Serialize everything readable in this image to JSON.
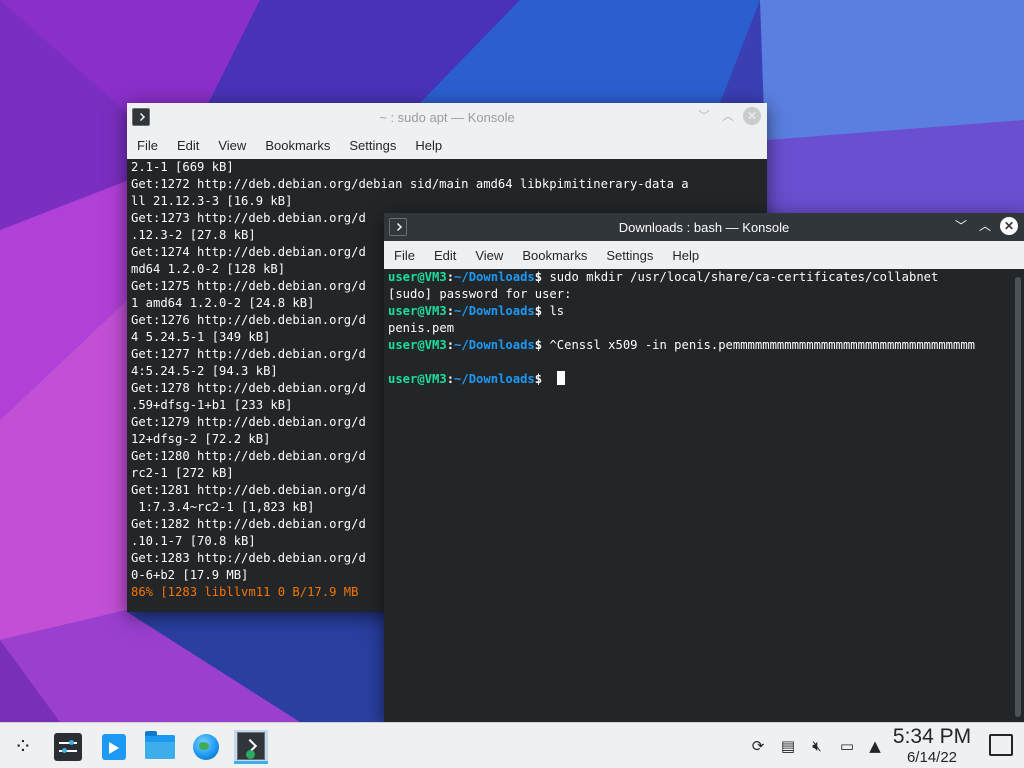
{
  "wallpaper": {
    "colors": [
      "#4a1f9e",
      "#8a3fd0",
      "#2c5fcf",
      "#6b7fd8"
    ]
  },
  "back_window": {
    "title": "~ : sudo apt — Konsole",
    "menu": [
      "File",
      "Edit",
      "View",
      "Bookmarks",
      "Settings",
      "Help"
    ],
    "lines": [
      "2.1-1 [669 kB]",
      "Get:1272 http://deb.debian.org/debian sid/main amd64 libkpimitinerary-data a",
      "ll 21.12.3-3 [16.9 kB]",
      "Get:1273 http://deb.debian.org/d",
      ".12.3-2 [27.8 kB]",
      "Get:1274 http://deb.debian.org/d",
      "md64 1.2.0-2 [128 kB]",
      "Get:1275 http://deb.debian.org/d",
      "1 amd64 1.2.0-2 [24.8 kB]",
      "Get:1276 http://deb.debian.org/d",
      "4 5.24.5-1 [349 kB]",
      "Get:1277 http://deb.debian.org/d",
      "4:5.24.5-2 [94.3 kB]",
      "Get:1278 http://deb.debian.org/d",
      ".59+dfsg-1+b1 [233 kB]",
      "Get:1279 http://deb.debian.org/d",
      "12+dfsg-2 [72.2 kB]",
      "Get:1280 http://deb.debian.org/d",
      "rc2-1 [272 kB]",
      "Get:1281 http://deb.debian.org/d",
      " 1:7.3.4~rc2-1 [1,823 kB]",
      "Get:1282 http://deb.debian.org/d",
      ".10.1-7 [70.8 kB]",
      "Get:1283 http://deb.debian.org/d",
      "0-6+b2 [17.9 MB]"
    ],
    "progress_line": "86% [1283 libllvm11 0 B/17.9 MB"
  },
  "front_window": {
    "title": "Downloads : bash — Konsole",
    "menu": [
      "File",
      "Edit",
      "View",
      "Bookmarks",
      "Settings",
      "Help"
    ],
    "prompt_user": "user@VM3",
    "prompt_sep": ":",
    "prompt_path": "~/Downloads",
    "prompt_sign": "$",
    "entries": [
      {
        "cmd": " sudo mkdir /usr/local/share/ca-certificates/collabnet",
        "output": "[sudo] password for user:"
      },
      {
        "cmd": " ls",
        "output": "penis.pem"
      },
      {
        "cmd": " ^Censsl x509 -in penis.pemmmmmmmmmmmmmmmmmmmmmmmmmmmmmmmmm",
        "output": ""
      }
    ]
  },
  "taskbar": {
    "apps": [
      "application-launcher-icon",
      "system-settings-icon",
      "discover-store-icon",
      "dolphin-folder-icon",
      "web-browser-globe-icon",
      "konsole-terminal-icon"
    ],
    "tray": [
      "updates-icon",
      "clipboard-icon",
      "volume-muted-icon",
      "network-wired-icon",
      "tray-expand-arrow-icon"
    ],
    "clock_time": "5:34 PM",
    "clock_date": "6/14/22"
  },
  "colors": {
    "accent": "#3daee9",
    "prompt_user": "#1cdc9a",
    "prompt_path": "#1d99f3",
    "progress": "#f67400",
    "terminal_bg": "#232629"
  }
}
